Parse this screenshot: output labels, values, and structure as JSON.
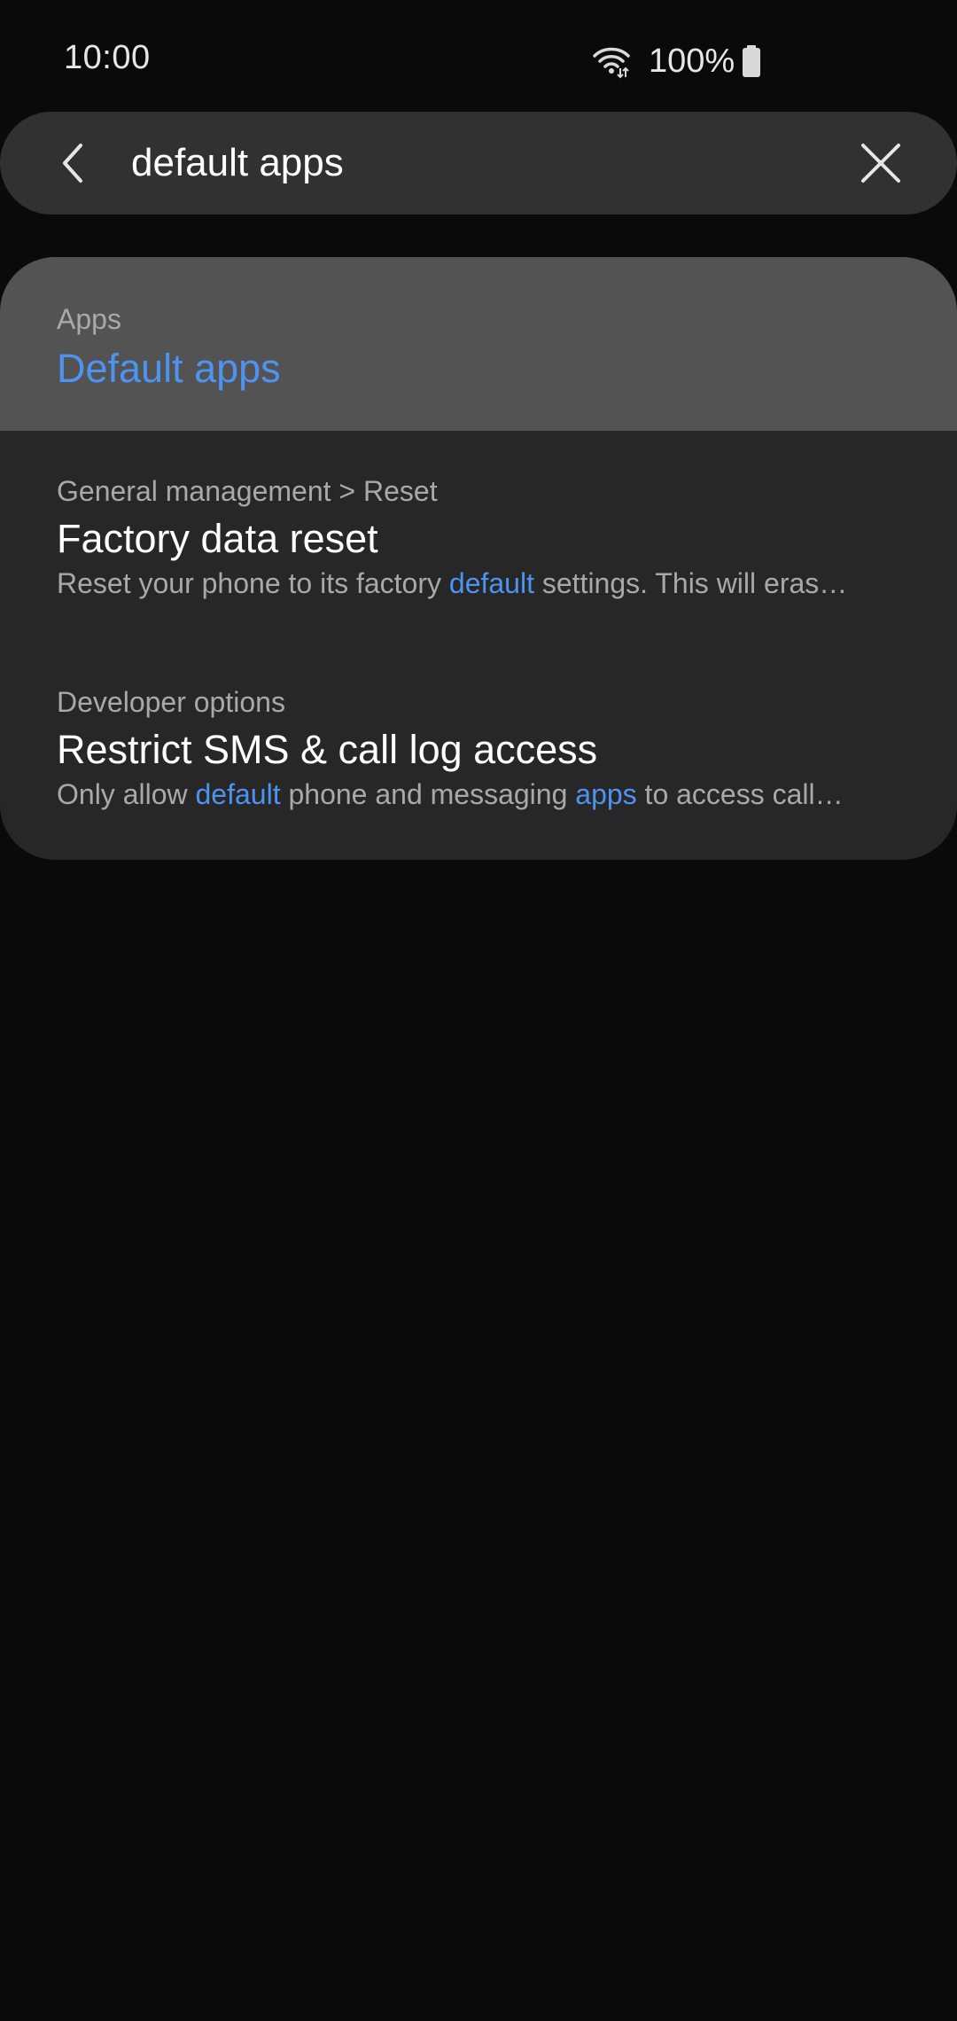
{
  "status_bar": {
    "time": "10:00",
    "battery_percent": "100%",
    "icons": [
      "wifi-icon",
      "battery-icon"
    ]
  },
  "search": {
    "query": "default apps",
    "back_icon": "chevron-left-icon",
    "clear_icon": "close-icon"
  },
  "results": [
    {
      "category": "Apps",
      "title": "Default apps",
      "title_highlighted": true
    },
    {
      "category": "General management > Reset",
      "title": "Factory data reset",
      "description_parts": [
        {
          "text": "Reset your phone to its factory ",
          "highlight": false
        },
        {
          "text": "default",
          "highlight": true
        },
        {
          "text": " settings. This will eras…",
          "highlight": false
        }
      ]
    },
    {
      "category": "Developer options",
      "title": "Restrict SMS & call log access",
      "description_parts": [
        {
          "text": "Only allow ",
          "highlight": false
        },
        {
          "text": "default",
          "highlight": true
        },
        {
          "text": " phone and messaging ",
          "highlight": false
        },
        {
          "text": "apps",
          "highlight": true
        },
        {
          "text": " to access call…",
          "highlight": false
        }
      ]
    }
  ],
  "colors": {
    "background": "#0a0a0b",
    "search_bar": "#313131",
    "card": "#272727",
    "highlight_row": "#535353",
    "accent": "#4e93f0",
    "secondary_text": "#a9a9a9"
  }
}
